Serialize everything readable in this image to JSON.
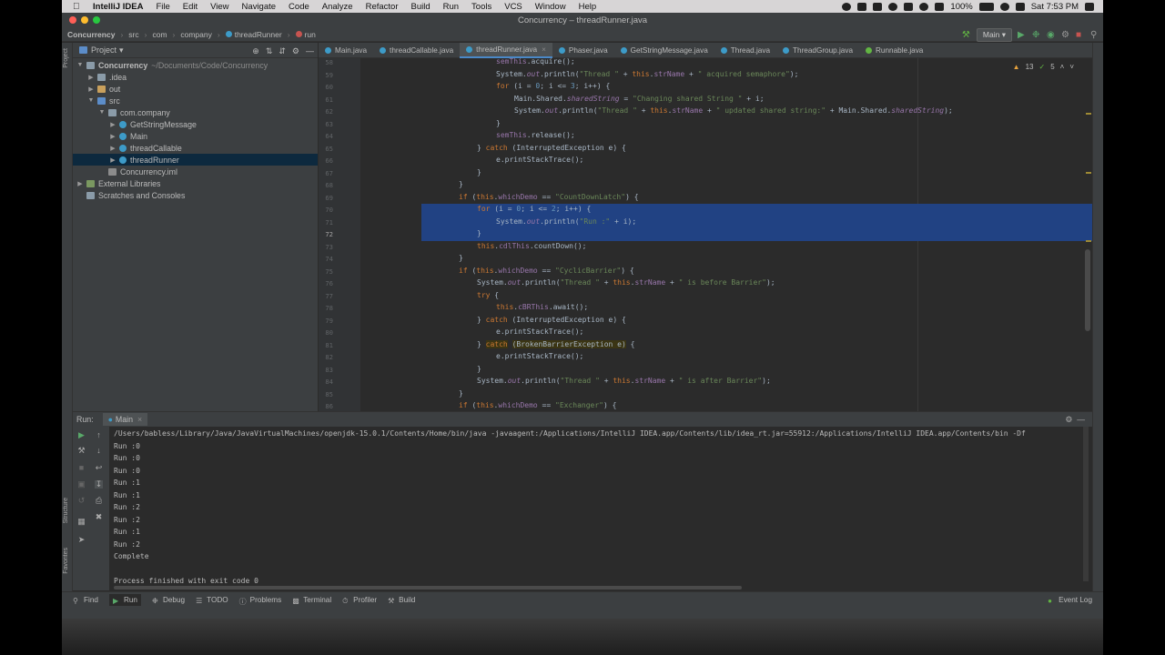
{
  "menubar": {
    "app": "IntelliJ IDEA",
    "items": [
      "File",
      "Edit",
      "View",
      "Navigate",
      "Code",
      "Analyze",
      "Refactor",
      "Build",
      "Run",
      "Tools",
      "VCS",
      "Window",
      "Help"
    ],
    "battery": "100%",
    "clock": "Sat 7:53 PM"
  },
  "window": {
    "title": "Concurrency – threadRunner.java"
  },
  "navbar": {
    "crumbs": [
      "Concurrency",
      "src",
      "com",
      "company",
      "threadRunner",
      "run"
    ],
    "run_config": "Main"
  },
  "project": {
    "label": "Project",
    "tree": [
      {
        "label": "Concurrency",
        "hint": "~/Documents/Code/Concurrency"
      },
      {
        "label": ".idea"
      },
      {
        "label": "out"
      },
      {
        "label": "src"
      },
      {
        "label": "com.company"
      },
      {
        "label": "GetStringMessage"
      },
      {
        "label": "Main"
      },
      {
        "label": "threadCallable"
      },
      {
        "label": "threadRunner"
      },
      {
        "label": "Concurrency.iml"
      },
      {
        "label": "External Libraries"
      },
      {
        "label": "Scratches and Consoles"
      }
    ]
  },
  "tabs": [
    "Main.java",
    "threadCallable.java",
    "threadRunner.java",
    "Phaser.java",
    "GetStringMessage.java",
    "Thread.java",
    "ThreadGroup.java",
    "Runnable.java"
  ],
  "editor": {
    "warnings": "13",
    "weak_warnings": "5",
    "line_numbers": [
      "58",
      "59",
      "60",
      "61",
      "62",
      "63",
      "64",
      "65",
      "66",
      "67",
      "68",
      "69",
      "70",
      "71",
      "72",
      "73",
      "74",
      "75",
      "76",
      "77",
      "78",
      "79",
      "80",
      "81",
      "82",
      "83",
      "84",
      "85",
      "86"
    ]
  },
  "run": {
    "label": "Run:",
    "tab": "Main",
    "cmd": "/Users/babless/Library/Java/JavaVirtualMachines/openjdk-15.0.1/Contents/Home/bin/java -javaagent:/Applications/IntelliJ IDEA.app/Contents/lib/idea_rt.jar=55912:/Applications/IntelliJ IDEA.app/Contents/bin -Df",
    "output": [
      "Run :0",
      "Run :0",
      "Run :0",
      "Run :1",
      "Run :1",
      "Run :2",
      "Run :2",
      "Run :1",
      "Run :2",
      "Complete",
      "",
      "Process finished with exit code 0"
    ]
  },
  "bottom_tabs": [
    "Find",
    "Run",
    "Debug",
    "TODO",
    "Problems",
    "Terminal",
    "Profiler",
    "Build"
  ],
  "event_log": "Event Log",
  "side_labels": {
    "project": "Project",
    "structure": "Structure",
    "favorites": "Favorites"
  }
}
